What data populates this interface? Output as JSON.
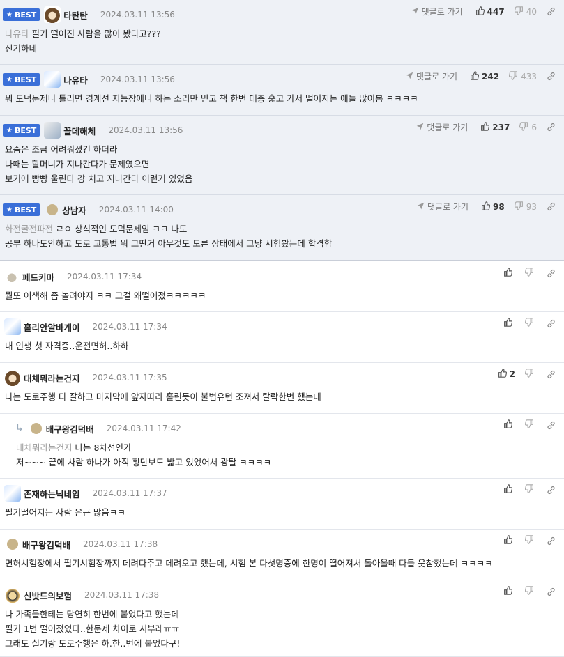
{
  "ui": {
    "best_label": "BEST",
    "reply_label": "댓글로 가기"
  },
  "best_comments": [
    {
      "nick": "타탄탄",
      "avatar": "bear-avatar",
      "date": "2024.03.11 13:56",
      "up": "447",
      "down": "40",
      "quote": "나유타",
      "lines": [
        "필기 떨어진 사람을 많이 봤다고???",
        "신기하네"
      ]
    },
    {
      "nick": "나유타",
      "avatar": "dog-avatar",
      "date": "2024.03.11 13:56",
      "up": "242",
      "down": "433",
      "quote": "",
      "lines": [
        "뭐 도덕문제니 틀리면 경계선 지능장애니 하는 소리만 믿고 책 한번 대충 훑고 가서 떨어지는 애들 많이봄 ㅋㅋㅋㅋ"
      ]
    },
    {
      "nick": "꼴데해체",
      "avatar": "cat-avatar",
      "date": "2024.03.11 13:56",
      "up": "237",
      "down": "6",
      "quote": "",
      "lines": [
        "요즘은 조금 어려워졌긴 하더라",
        "나때는 할머니가 지나간다가 문제였으면",
        "보기에 빵빵 울린다 걍 치고 지나간다 이런거 있었음"
      ]
    },
    {
      "nick": "상남자",
      "avatar": "circle-avatar",
      "date": "2024.03.11 14:00",
      "up": "98",
      "down": "93",
      "quote": "화전굴전파전",
      "lines": [
        "ㄹㅇ 상식적인 도덕문제임 ㅋㅋ 나도",
        "공부 하나도안하고 도로 교통법 뭐 그딴거 아무것도 모른 상태에서 그냥 시험봤는데 합격함"
      ]
    }
  ],
  "comments": [
    {
      "nick": "페드키마",
      "avatar": "seal-avatar",
      "date": "2024.03.11 17:34",
      "up": "",
      "quote": "",
      "lines": [
        "뭘또 어색해 좀 놀려야지 ㅋㅋ 그걸 왜떨어졌ㅋㅋㅋㅋㅋ"
      ]
    },
    {
      "nick": "홀리안알바게이",
      "avatar": "dog-avatar",
      "date": "2024.03.11 17:34",
      "up": "",
      "quote": "",
      "lines": [
        "내 인생 첫 자격증..운전면허..하하"
      ]
    },
    {
      "nick": "대체뭐라는건지",
      "avatar": "bear-avatar",
      "date": "2024.03.11 17:35",
      "up": "2",
      "quote": "",
      "lines": [
        "나는 도로주행 다 잘하고 마지막에 앞자따라 홀린듯이 불법유턴 조져서 탈락한번 했는데"
      ]
    },
    {
      "nick": "배구왕김덕배",
      "avatar": "circle-avatar",
      "date": "2024.03.11 17:42",
      "up": "",
      "quote": "대체뭐라는건지",
      "reply": true,
      "lines": [
        "나는 8차선인가",
        "저~~~ 끝에 사람 하나가 아직 횡단보도 밟고 있었어서 광탈 ㅋㅋㅋㅋ"
      ]
    },
    {
      "nick": "존재하는닉네임",
      "avatar": "dog-avatar",
      "date": "2024.03.11 17:37",
      "up": "",
      "quote": "",
      "lines": [
        "필기떨어지는 사람 은근 많음ㅋㅋ"
      ]
    },
    {
      "nick": "배구왕김덕배",
      "avatar": "circle-avatar",
      "date": "2024.03.11 17:38",
      "up": "",
      "quote": "",
      "lines": [
        "면허시험장에서 필기시험장까지 데려다주고 데려오고 했는데, 시험 본 다섯명중에 한명이 떨어져서 돌아올때 다들 웃참했는데 ㅋㅋㅋㅋ"
      ]
    },
    {
      "nick": "신밧드의보험",
      "avatar": "fox-avatar",
      "date": "2024.03.11 17:38",
      "up": "",
      "quote": "",
      "lines": [
        "나 가족들한테는 당연히 한번에 붙었다고 했는데",
        "필기 1번 떨어졌었다..한문제 차이로 시부레ㅠㅠ",
        "그래도 실기랑 도로주행은 하.한..번에 붙었다구!"
      ]
    }
  ]
}
